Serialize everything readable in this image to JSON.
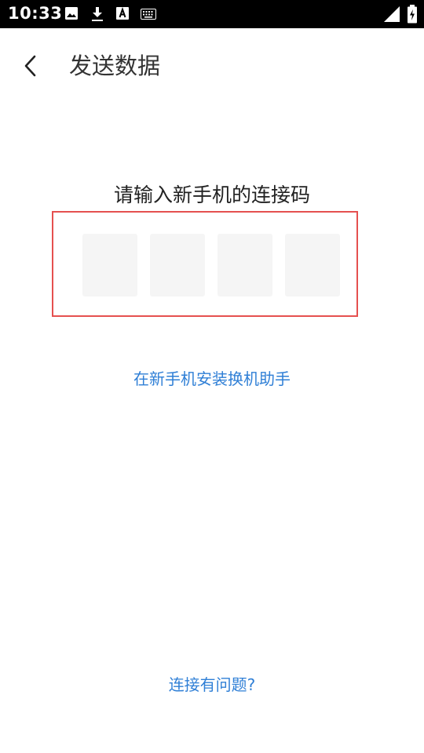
{
  "status_bar": {
    "time": "10:33",
    "icons": [
      "image-icon",
      "download-icon",
      "text-a-icon",
      "keyboard-icon",
      "signal-icon",
      "battery-icon"
    ]
  },
  "header": {
    "title": "发送数据",
    "back_icon": "chevron-left-icon"
  },
  "main": {
    "prompt": "请输入新手机的连接码",
    "code_boxes": [
      "",
      "",
      "",
      ""
    ],
    "install_link": "在新手机安装换机助手",
    "problem_link": "连接有问题?"
  },
  "colors": {
    "link": "#2f7fd6",
    "highlight_border": "#e5504f",
    "code_box_bg": "#f5f5f5"
  }
}
